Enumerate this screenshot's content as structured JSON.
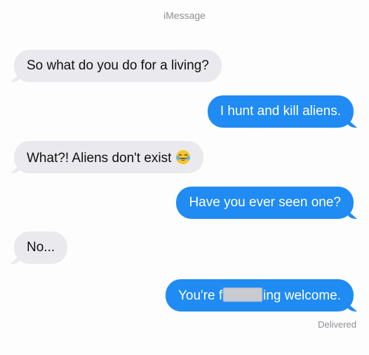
{
  "header": {
    "service_label": "iMessage"
  },
  "messages": [
    {
      "direction": "incoming",
      "text": "So what do you do for a living?"
    },
    {
      "direction": "outgoing",
      "text": "I hunt and kill aliens."
    },
    {
      "direction": "incoming",
      "text": "What?! Aliens don't exist",
      "emoji": "laughing-crying-emoji"
    },
    {
      "direction": "outgoing",
      "text": "Have you ever seen one?"
    },
    {
      "direction": "incoming",
      "text": "No..."
    },
    {
      "direction": "outgoing",
      "text_before": "You're f",
      "text_after": "ing welcome.",
      "censored": true
    }
  ],
  "status": {
    "delivered_label": "Delivered"
  },
  "colors": {
    "outgoing_bubble": "#1f8bf3",
    "incoming_bubble": "#e9e9ee",
    "meta_text": "#8e8e93"
  }
}
